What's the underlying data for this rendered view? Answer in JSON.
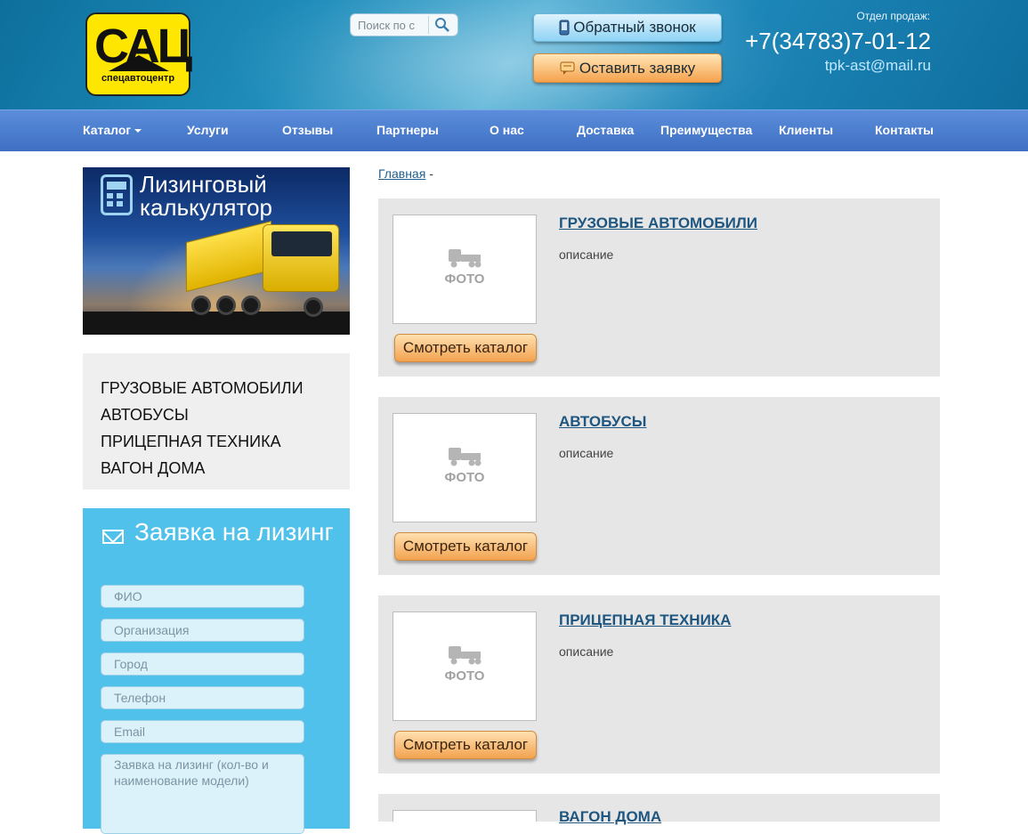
{
  "header": {
    "logo_big": "САЦ",
    "logo_small": "спецавтоцентр",
    "search_placeholder": "Поиск по с",
    "callback_label": "Обратный звонок",
    "order_label": "Оставить заявку",
    "sales_label": "Отдел продаж:",
    "phone": "+7(34783)7-01-12",
    "email": "tpk-ast@mail.ru"
  },
  "nav": {
    "items": [
      "Каталог",
      "Услуги",
      "Отзывы",
      "Партнеры",
      "О нас",
      "Доставка",
      "Преимущества",
      "Клиенты",
      "Контакты"
    ]
  },
  "sidebar": {
    "banner_title": "Лизинговый калькулятор",
    "categories": [
      "ГРУЗОВЫЕ АВТОМОБИЛИ",
      "АВТОБУСЫ",
      "ПРИЦЕПНАЯ ТЕХНИКА",
      "ВАГОН ДОМА"
    ],
    "lease_form": {
      "title": "Заявка на лизинг",
      "placeholders": [
        "ФИО",
        "Организация",
        "Город",
        "Телефон",
        "Email",
        "Заявка на лизинг (кол-во и наименование модели)"
      ]
    }
  },
  "main": {
    "breadcrumb_home": "Главная",
    "breadcrumb_sep": "-",
    "photo_placeholder": "ФОТО",
    "cards": [
      {
        "title": "ГРУЗОВЫЕ АВТОМОБИЛИ",
        "desc": "описание",
        "button": "Смотреть каталог"
      },
      {
        "title": "АВТОБУСЫ",
        "desc": "описание",
        "button": "Смотреть каталог"
      },
      {
        "title": "ПРИЦЕПНАЯ ТЕХНИКА",
        "desc": "описание",
        "button": "Смотреть каталог"
      },
      {
        "title": "ВАГОН ДОМА",
        "desc": "",
        "button": ""
      }
    ]
  },
  "colors": {
    "header": "#1a80b3",
    "nav": "#4a7ccd",
    "lease_panel": "#4fc1ea",
    "card_bg": "#e6e6e6",
    "button_orange": "#f2a350"
  }
}
